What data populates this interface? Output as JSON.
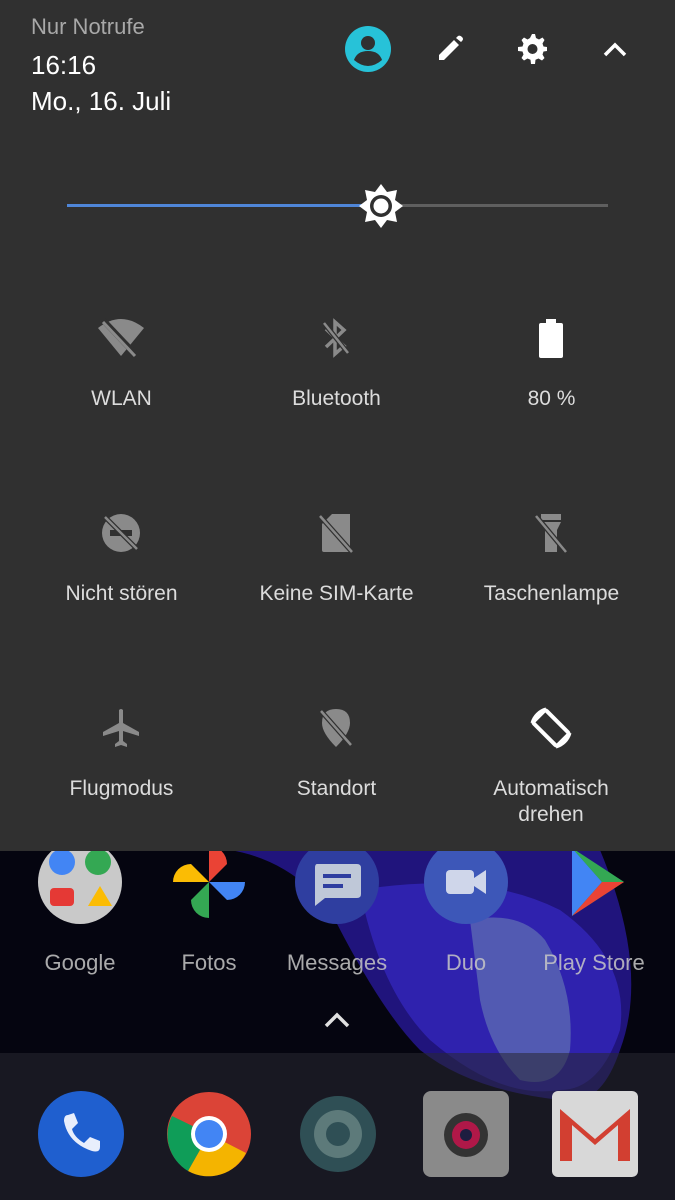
{
  "status": {
    "carrier": "Nur Notrufe",
    "time": "16:16",
    "date": "Mo., 16. Juli"
  },
  "header_icons": [
    "account-icon",
    "edit-icon",
    "settings-icon",
    "collapse-icon"
  ],
  "brightness": {
    "level": 0.58,
    "accent": "#4f86d8"
  },
  "tiles": [
    {
      "label": "WLAN",
      "icon": "wifi-off-icon",
      "active": false
    },
    {
      "label": "Bluetooth",
      "icon": "bluetooth-off-icon",
      "active": false
    },
    {
      "label": "80 %",
      "icon": "battery-icon",
      "active": true
    },
    {
      "label": "Nicht stören",
      "icon": "do-not-disturb-icon",
      "active": false
    },
    {
      "label": "Keine SIM-Karte",
      "icon": "no-sim-icon",
      "active": false
    },
    {
      "label": "Taschenlampe",
      "icon": "flashlight-off-icon",
      "active": false
    },
    {
      "label": "Flugmodus",
      "icon": "airplane-icon",
      "active": false
    },
    {
      "label": "Standort",
      "icon": "location-off-icon",
      "active": false
    },
    {
      "label": "Automatisch drehen",
      "icon": "auto-rotate-icon",
      "active": true
    }
  ],
  "apps": [
    {
      "label": "Google",
      "icon": "google-folder-icon"
    },
    {
      "label": "Fotos",
      "icon": "photos-icon"
    },
    {
      "label": "Messages",
      "icon": "messages-icon"
    },
    {
      "label": "Duo",
      "icon": "duo-icon"
    },
    {
      "label": "Play Store",
      "icon": "play-store-icon"
    }
  ],
  "dock": [
    "phone-icon",
    "chrome-icon",
    "settings-app-icon",
    "camera-icon",
    "gmail-icon"
  ],
  "colors": {
    "panel": "#303030",
    "account": "#27c2d8"
  }
}
